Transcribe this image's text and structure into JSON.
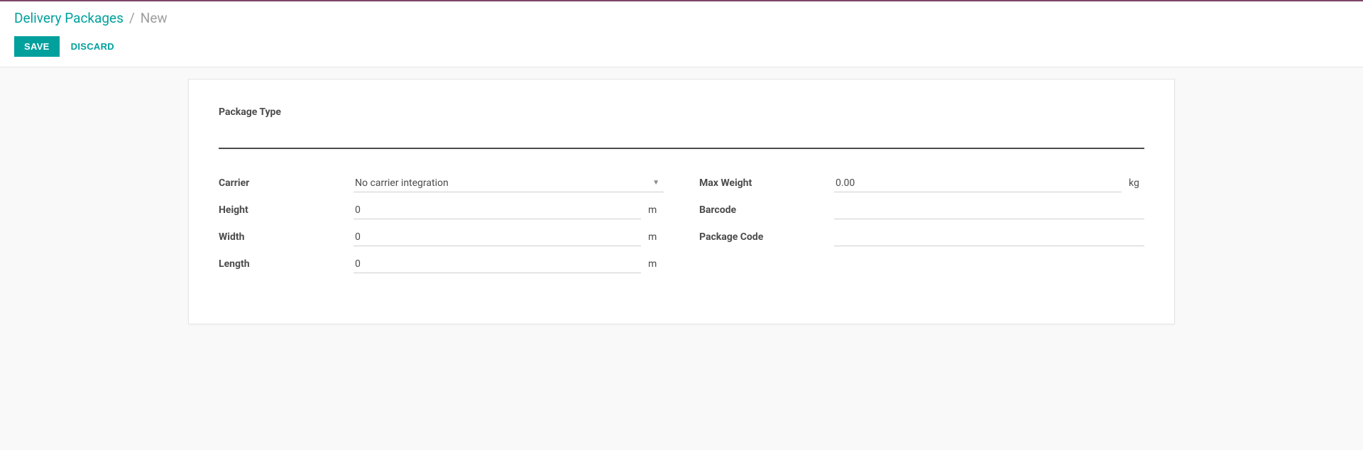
{
  "breadcrumb": {
    "parent": "Delivery Packages",
    "separator": "/",
    "current": "New"
  },
  "actions": {
    "save": "SAVE",
    "discard": "DISCARD"
  },
  "form": {
    "title_label": "Package Type",
    "left": {
      "carrier": {
        "label": "Carrier",
        "value": "No carrier integration"
      },
      "height": {
        "label": "Height",
        "value": "0",
        "unit": "m"
      },
      "width": {
        "label": "Width",
        "value": "0",
        "unit": "m"
      },
      "length": {
        "label": "Length",
        "value": "0",
        "unit": "m"
      }
    },
    "right": {
      "max_weight": {
        "label": "Max Weight",
        "value": "0.00",
        "unit": "kg"
      },
      "barcode": {
        "label": "Barcode",
        "value": ""
      },
      "package_code": {
        "label": "Package Code",
        "value": ""
      }
    }
  }
}
